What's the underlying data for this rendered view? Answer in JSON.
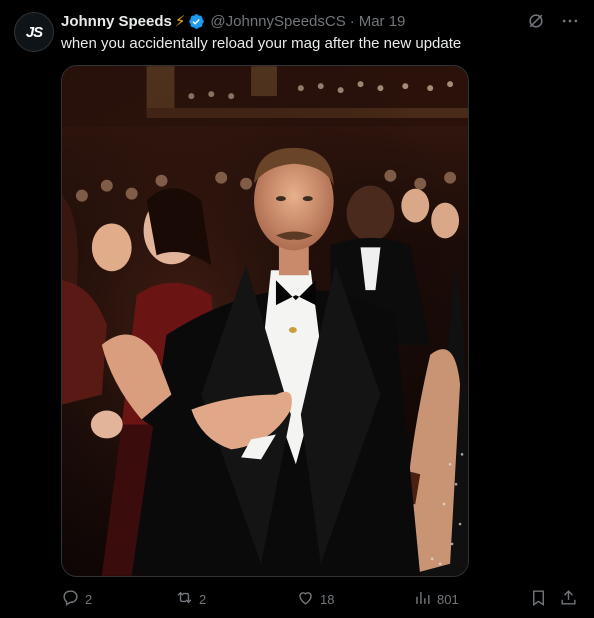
{
  "author": {
    "avatar_text": "JS",
    "display_name": "Johnny Speeds",
    "emoji": "⚡",
    "handle": "@JohnnySpeedsCS",
    "separator": "·",
    "date": "Mar 19"
  },
  "tweet": {
    "text": "when you accidentally reload your mag after the new update"
  },
  "media": {
    "alt": "Photo of a smiling man in a tuxedo shrugging with open palms in a theater audience"
  },
  "actions": {
    "replies": "2",
    "reposts": "2",
    "likes": "18",
    "views": "801"
  },
  "colors": {
    "background": "#000000",
    "text": "#e7e9ea",
    "muted": "#71767b",
    "verified": "#1d9bf0",
    "border": "#2f3336"
  },
  "icons": [
    "verified-badge-icon",
    "grok-icon",
    "more-icon",
    "reply-icon",
    "repost-icon",
    "like-icon",
    "views-icon",
    "bookmark-icon",
    "share-icon"
  ]
}
